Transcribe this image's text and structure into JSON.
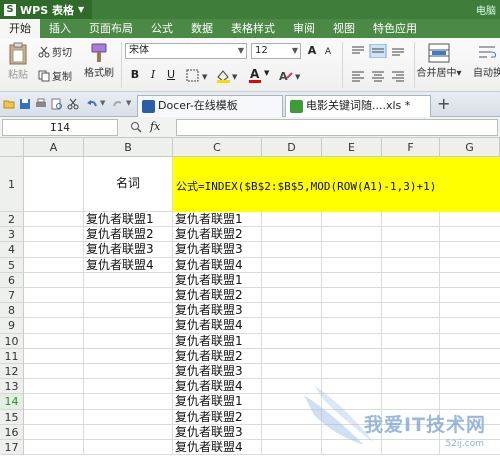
{
  "app": {
    "name": "WPS 表格",
    "logo_letter": "S",
    "right_text": "电脑"
  },
  "menu": {
    "tabs": [
      "开始",
      "插入",
      "页面布局",
      "公式",
      "数据",
      "表格样式",
      "审阅",
      "视图",
      "特色应用"
    ]
  },
  "ribbon": {
    "cut": "剪切",
    "paste": "粘贴",
    "copy": "复制",
    "format_painter": "格式刷",
    "font": "宋体",
    "font_size": "12",
    "bold": "B",
    "italic": "I",
    "underline": "U",
    "merge_center": "合并居中",
    "auto_wrap": "自动换",
    "font_color_label": "A"
  },
  "doc_tabs": [
    {
      "label": "Docer-在线模板",
      "icon": "docer-icon"
    },
    {
      "label": "电影关键词随....xls *",
      "icon": "spreadsheet-icon"
    }
  ],
  "add_tab": "+",
  "formula_bar": {
    "cell_ref": "I14",
    "fx_label": "fx",
    "value": ""
  },
  "grid": {
    "columns": [
      "A",
      "B",
      "C",
      "D",
      "E",
      "F",
      "G"
    ],
    "rows": [
      "1",
      "2",
      "3",
      "4",
      "5",
      "6",
      "7",
      "8",
      "9",
      "10",
      "11",
      "12",
      "13",
      "14",
      "15",
      "16",
      "17"
    ],
    "selected_row": "14",
    "b_header": "名词",
    "formula_display": "公式=INDEX($B$2:$B$5,MOD(ROW(A1)-1,3)+1)",
    "b_values": [
      "复仇者联盟1",
      "复仇者联盟2",
      "复仇者联盟3",
      "复仇者联盟4"
    ],
    "c_values": [
      "复仇者联盟1",
      "复仇者联盟2",
      "复仇者联盟3",
      "复仇者联盟4",
      "复仇者联盟1",
      "复仇者联盟2",
      "复仇者联盟3",
      "复仇者联盟4",
      "复仇者联盟1",
      "复仇者联盟2",
      "复仇者联盟3",
      "复仇者联盟4",
      "复仇者联盟1",
      "复仇者联盟2",
      "复仇者联盟3",
      "复仇者联盟4"
    ],
    "highlight_color": "#ffff00"
  },
  "watermark": {
    "text": "我爱IT技术网",
    "url": "52ij.com"
  }
}
